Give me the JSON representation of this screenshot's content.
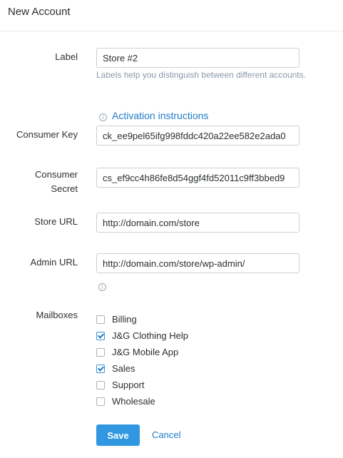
{
  "header": {
    "title": "New Account"
  },
  "form": {
    "label": {
      "label": "Label",
      "value": "Store #2",
      "help": "Labels help you distinguish between different accounts."
    },
    "activation_link": "Activation instructions",
    "consumer_key": {
      "label": "Consumer Key",
      "value": "ck_ee9pel65ifg998fddc420a22ee582e2ada0"
    },
    "consumer_secret": {
      "label_line1": "Consumer",
      "label_line2": "Secret",
      "value": "cs_ef9cc4h86fe8d54ggf4fd52011c9ff3bbed9"
    },
    "store_url": {
      "label": "Store URL",
      "value": "http://domain.com/store"
    },
    "admin_url": {
      "label": "Admin URL",
      "value": "http://domain.com/store/wp-admin/"
    },
    "mailboxes": {
      "label": "Mailboxes",
      "items": [
        {
          "label": "Billing",
          "checked": false
        },
        {
          "label": "J&G Clothing Help",
          "checked": true
        },
        {
          "label": "J&G Mobile App",
          "checked": false
        },
        {
          "label": "Sales",
          "checked": true
        },
        {
          "label": "Support",
          "checked": false
        },
        {
          "label": "Wholesale",
          "checked": false
        }
      ]
    }
  },
  "actions": {
    "save_label": "Save",
    "cancel_label": "Cancel"
  },
  "icons": {
    "info": "info-icon",
    "checkmark": "checkmark-icon"
  },
  "colors": {
    "accent": "#3197e0",
    "link": "#1f7ac7",
    "help_text": "#8a99a8"
  }
}
